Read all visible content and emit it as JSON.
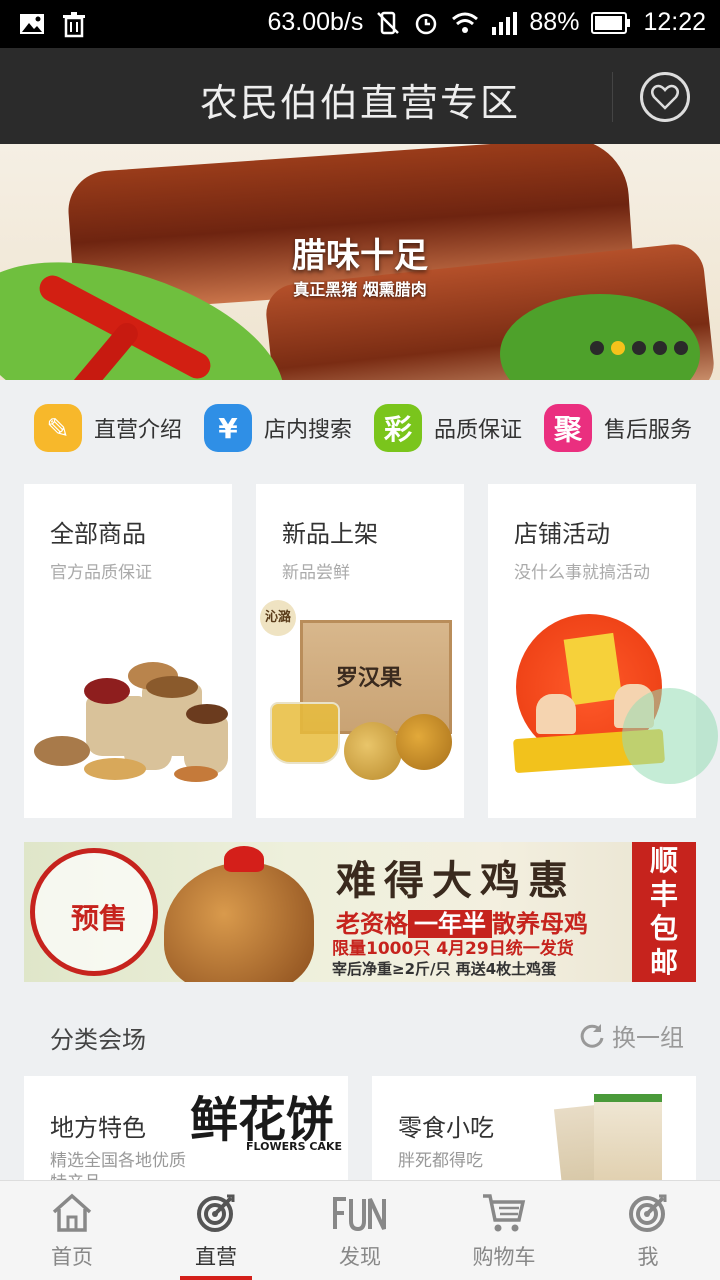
{
  "status_bar": {
    "speed": "63.00b/s",
    "battery": "88%",
    "time": "12:22"
  },
  "header": {
    "title": "农民伯伯直营专区",
    "favorite_icon": "heart-icon"
  },
  "banner": {
    "title": "腊味十足",
    "subtitle": "真正黑猪 烟熏腊肉",
    "active_slide": 2,
    "slide_count": 5
  },
  "quick_links": [
    {
      "label": "直营介绍",
      "icon": "pencil-icon",
      "glyph": "✎",
      "color": "#f7b82b"
    },
    {
      "label": "店内搜索",
      "icon": "yen-icon",
      "glyph": "¥",
      "color": "#2f8fe6"
    },
    {
      "label": "品质保证",
      "icon": "cai-icon",
      "glyph": "彩",
      "color": "#7ac51c"
    },
    {
      "label": "售后服务",
      "icon": "ju-icon",
      "glyph": "聚",
      "color": "#ea2f7f"
    }
  ],
  "cards": [
    {
      "title": "全部商品",
      "subtitle": "官方品质保证"
    },
    {
      "title": "新品上架",
      "subtitle": "新品尝鲜"
    },
    {
      "title": "店铺活动",
      "subtitle": "没什么事就搞活动"
    }
  ],
  "product_box": {
    "brand": "沁潞",
    "name": "罗汉果"
  },
  "promo": {
    "stamp": "预售",
    "title": "难得大鸡惠",
    "line2_a": "老资格",
    "line2_box": "一年半",
    "line2_b": "散养母鸡",
    "line3": "限量1000只 4月29日统一发货",
    "line4": "宰后净重≥2斤/只 再送4枚土鸡蛋",
    "side": "顺丰包邮"
  },
  "section": {
    "title": "分类会场",
    "refresh_label": "换一组"
  },
  "bottom_cards": [
    {
      "title": "地方特色",
      "subtitle": "精选全国各地优质特产品",
      "image_text": "鲜花饼",
      "image_sub": "FLOWERS CAKE"
    },
    {
      "title": "零食小吃",
      "subtitle": "胖死都得吃"
    }
  ],
  "tabs": [
    {
      "label": "首页",
      "icon": "home-icon"
    },
    {
      "label": "直营",
      "icon": "target-icon"
    },
    {
      "label": "发现",
      "icon": "fun-icon"
    },
    {
      "label": "购物车",
      "icon": "cart-icon"
    },
    {
      "label": "我",
      "icon": "target-icon"
    }
  ],
  "active_tab": 1,
  "colors": {
    "accent": "#d41f1a",
    "header_bg": "#2b2b2b",
    "page_bg": "#eef0f2"
  }
}
